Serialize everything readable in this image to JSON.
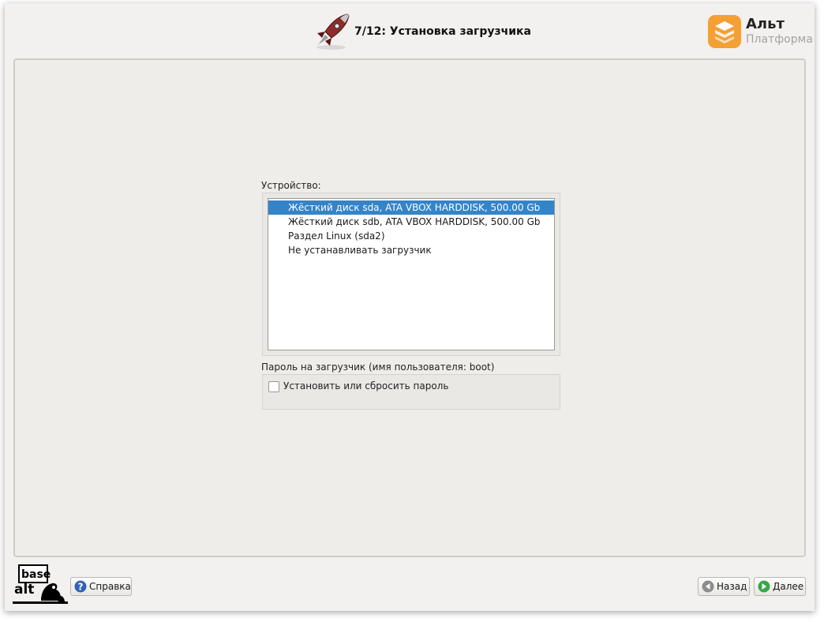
{
  "header": {
    "title": "7/12: Установка загрузчика",
    "brand_name": "Альт",
    "brand_sub": "Платформа"
  },
  "device": {
    "label": "Устройство:",
    "items": [
      {
        "label": "Жёсткий диск sda, ATA VBOX HARDDISK, 500.00 Gb",
        "selected": true
      },
      {
        "label": "Жёсткий диск sdb, ATA VBOX HARDDISK, 500.00 Gb",
        "selected": false
      },
      {
        "label": "Раздел Linux (sda2)",
        "selected": false
      },
      {
        "label": "Не устанавливать загрузчик",
        "selected": false
      }
    ]
  },
  "password": {
    "label": "Пароль на загрузчик (имя пользователя: boot)",
    "checkbox_label": "Установить или сбросить пароль",
    "checked": false
  },
  "footer": {
    "help_label": "Справка",
    "back_label": "Назад",
    "next_label": "Далее"
  },
  "colors": {
    "selection": "#3584c8",
    "brand_orange": "#f4a035",
    "next_green": "#3aa64a"
  },
  "icons": {
    "header": "rocket-icon",
    "brand": "alt-platform-logo-icon",
    "help": "help-question-icon",
    "back": "arrow-left-icon",
    "next": "arrow-right-icon"
  }
}
